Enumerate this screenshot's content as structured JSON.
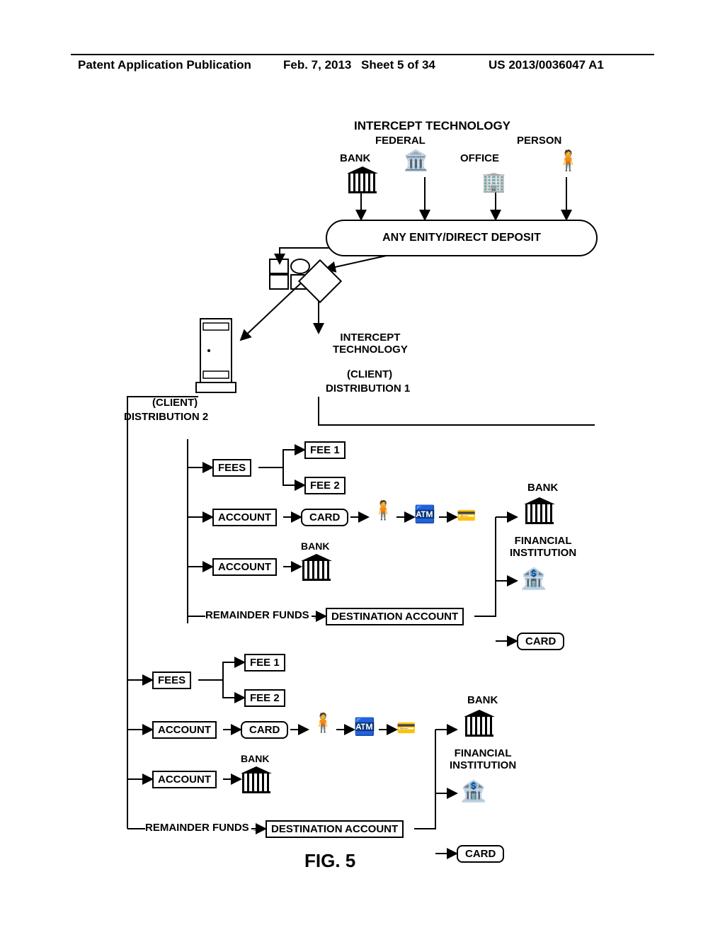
{
  "header": {
    "left": "Patent Application Publication",
    "date": "Feb. 7, 2013",
    "sheet": "Sheet 5 of 34",
    "pubno": "US 2013/0036047 A1"
  },
  "top": {
    "title": "INTERCEPT TECHNOLOGY",
    "federal": "FEDERAL",
    "person": "PERSON",
    "bank": "BANK",
    "office": "OFFICE",
    "cloud": "ANY ENITY/DIRECT DEPOSIT",
    "intercept": "INTERCEPT\nTECHNOLOGY",
    "dist1_a": "(CLIENT)",
    "dist1_b": "DISTRIBUTION 1",
    "dist2_a": "(CLIENT)",
    "dist2_b": "DISTRIBUTION 2"
  },
  "block1": {
    "fees": "FEES",
    "fee1": "FEE 1",
    "fee2": "FEE 2",
    "account1": "ACCOUNT",
    "card": "CARD",
    "bank_small": "BANK",
    "account2": "ACCOUNT",
    "remainder": "REMAINDER FUNDS",
    "dest": "DESTINATION ACCOUNT",
    "bank_big": "BANK",
    "fin_inst": "FINANCIAL\nINSTITUTION",
    "card_out": "CARD"
  },
  "block2": {
    "fees": "FEES",
    "fee1": "FEE 1",
    "fee2": "FEE 2",
    "account1": "ACCOUNT",
    "card": "CARD",
    "bank_small": "BANK",
    "account2": "ACCOUNT",
    "remainder": "REMAINDER FUNDS",
    "dest": "DESTINATION ACCOUNT",
    "bank_big": "BANK",
    "fin_inst": "FINANCIAL\nINSTITUTION",
    "card_out": "CARD"
  },
  "figure": "FIG. 5"
}
